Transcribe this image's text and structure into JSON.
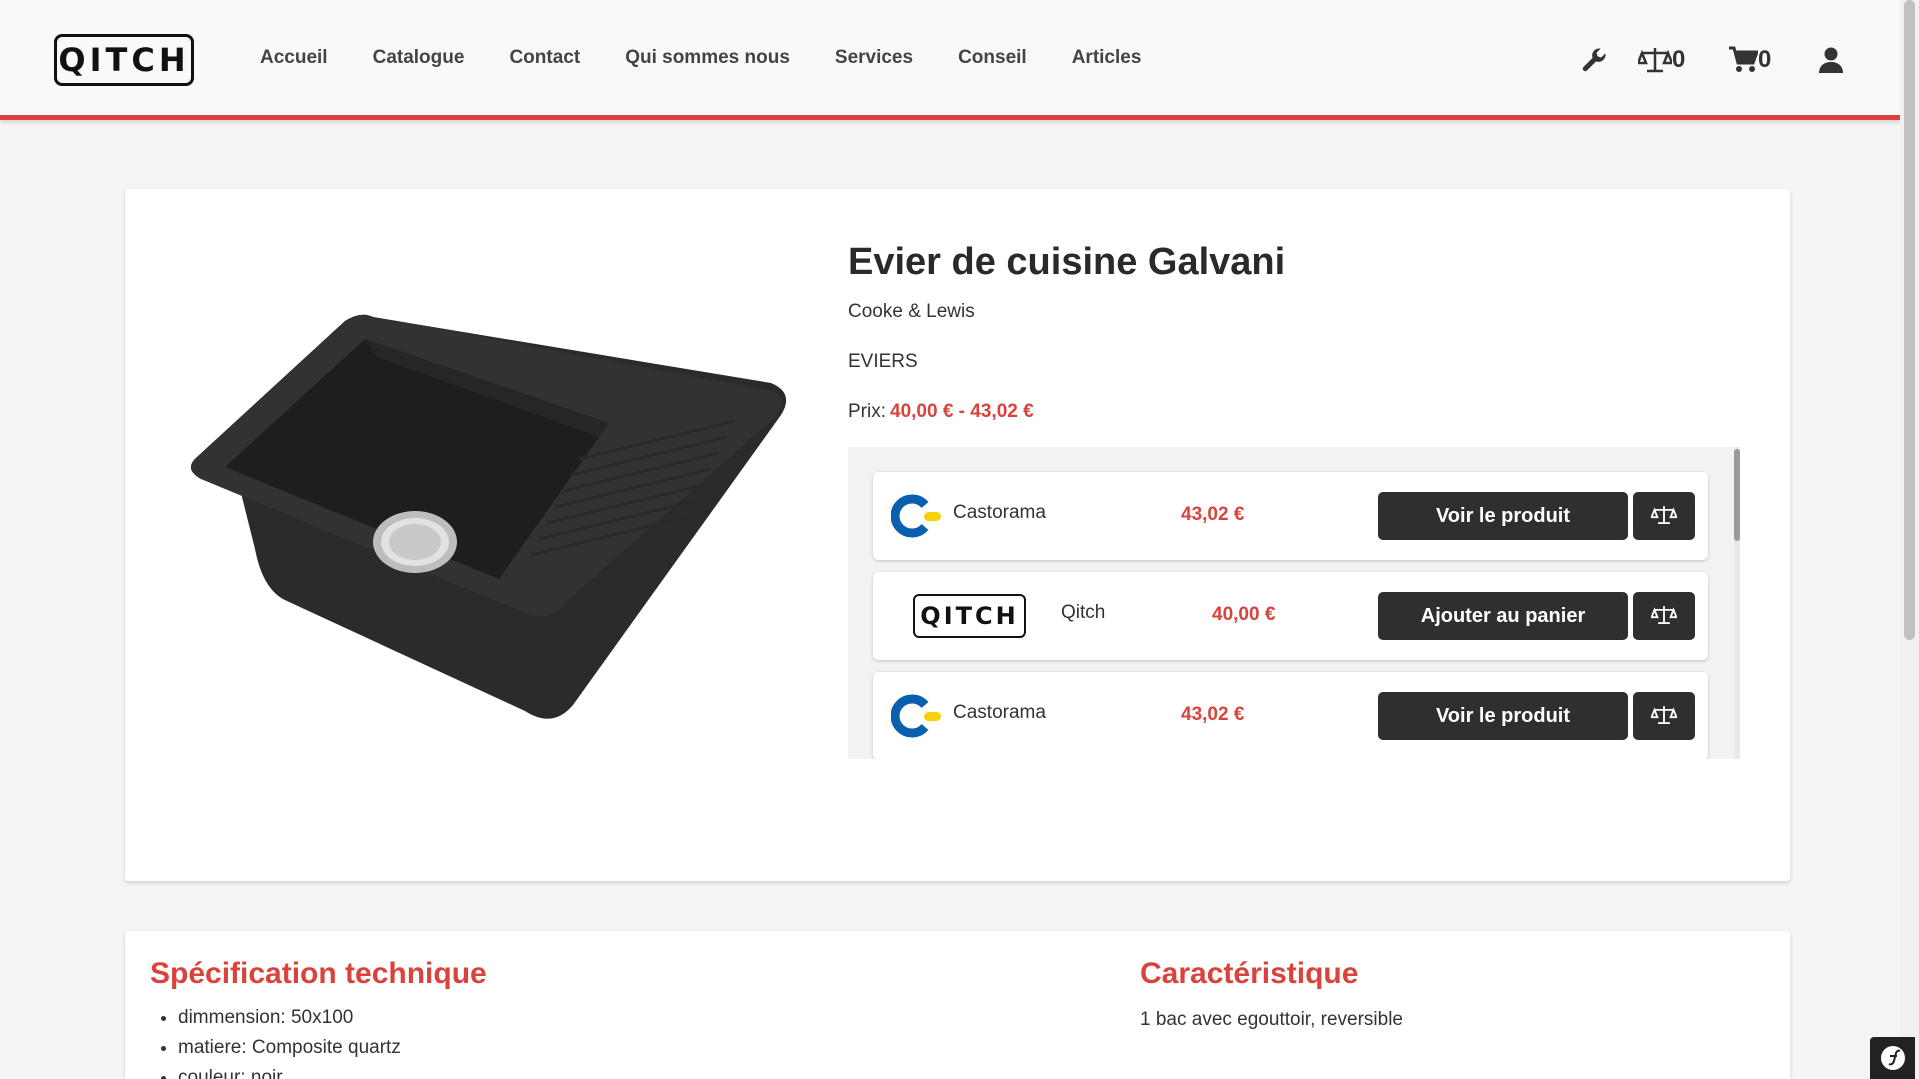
{
  "header": {
    "logo_text": "QITCH",
    "nav": [
      "Accueil",
      "Catalogue",
      "Contact",
      "Qui sommes nous",
      "Services",
      "Conseil",
      "Articles"
    ],
    "compare_count": "0",
    "cart_count": "0",
    "icons": [
      "wrench-icon",
      "scale-icon",
      "cart-icon",
      "user-icon"
    ]
  },
  "product": {
    "title": "Evier de cuisine Galvani",
    "brand": "Cooke & Lewis",
    "category": "EVIERS",
    "price_label": "Prix:",
    "price_range": "40,00 € - 43,02 €",
    "image_icon": "sink-image"
  },
  "offers": [
    {
      "store": "Castorama",
      "price": "43,02 €",
      "action": "Voir le produit",
      "logo": "castorama-logo"
    },
    {
      "store": "Qitch",
      "price": "40,00 €",
      "action": "Ajouter au panier",
      "logo": "qitch-logo",
      "logo_text": "QITCH"
    },
    {
      "store": "Castorama",
      "price": "43,02 €",
      "action": "Voir le produit",
      "logo": "castorama-logo"
    }
  ],
  "specs": {
    "title": "Spécification technique",
    "items": [
      "dimmension: 50x100",
      "matiere: Composite quartz",
      "couleur: noir"
    ]
  },
  "characteristics": {
    "title": "Caractéristique",
    "text": "1 bac avec egouttoir, reversible"
  },
  "colors": {
    "accent": "#d9433b",
    "button": "#2f2f2f",
    "castorama_blue": "#0a5fae",
    "castorama_yellow": "#f5d20a"
  }
}
